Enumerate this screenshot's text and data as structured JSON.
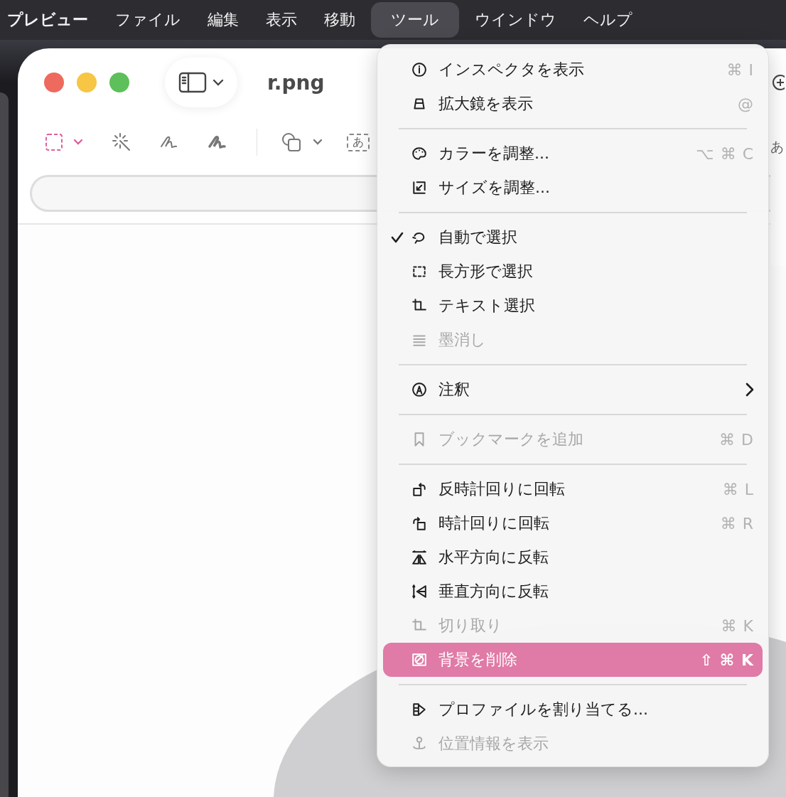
{
  "menu_bar": [
    {
      "label": "プレビュー",
      "selected": false,
      "app": true
    },
    {
      "label": "ファイル",
      "selected": false,
      "app": false
    },
    {
      "label": "編集",
      "selected": false,
      "app": false
    },
    {
      "label": "表示",
      "selected": false,
      "app": false
    },
    {
      "label": "移動",
      "selected": false,
      "app": false
    },
    {
      "label": "ツール",
      "selected": true,
      "app": false
    },
    {
      "label": "ウインドウ",
      "selected": false,
      "app": false
    },
    {
      "label": "ヘルプ",
      "selected": false,
      "app": false
    }
  ],
  "window": {
    "title": "r.png",
    "text_box_tool": "あ",
    "side_text": "あ"
  },
  "menu": {
    "sections": [
      {
        "items": [
          {
            "label": "インスペクタを表示",
            "shortcut": "⌘ I",
            "checked": false,
            "disabled": false,
            "selected": false,
            "submenu": false
          },
          {
            "label": "拡大鏡を表示",
            "shortcut": "@",
            "checked": false,
            "disabled": false,
            "selected": false,
            "submenu": false
          }
        ]
      },
      {
        "items": [
          {
            "label": "カラーを調整...",
            "shortcut": "⌥ ⌘ C",
            "checked": false,
            "disabled": false,
            "selected": false,
            "submenu": false
          },
          {
            "label": "サイズを調整...",
            "checked": false,
            "disabled": false,
            "selected": false,
            "submenu": false
          }
        ]
      },
      {
        "items": [
          {
            "label": "自動で選択",
            "checked": true,
            "disabled": false,
            "selected": false,
            "submenu": false
          },
          {
            "label": "長方形で選択",
            "checked": false,
            "disabled": false,
            "selected": false,
            "submenu": false
          },
          {
            "label": "テキスト選択",
            "checked": false,
            "disabled": false,
            "selected": false,
            "submenu": false
          },
          {
            "label": "墨消し",
            "checked": false,
            "disabled": true,
            "selected": false,
            "submenu": false
          }
        ]
      },
      {
        "items": [
          {
            "label": "注釈",
            "checked": false,
            "disabled": false,
            "selected": false,
            "submenu": true
          }
        ]
      },
      {
        "items": [
          {
            "label": "ブックマークを追加",
            "shortcut": "⌘ D",
            "checked": false,
            "disabled": true,
            "selected": false,
            "submenu": false
          }
        ]
      },
      {
        "items": [
          {
            "label": "反時計回りに回転",
            "shortcut": "⌘ L",
            "checked": false,
            "disabled": false,
            "selected": false,
            "submenu": false
          },
          {
            "label": "時計回りに回転",
            "shortcut": "⌘ R",
            "checked": false,
            "disabled": false,
            "selected": false,
            "submenu": false
          },
          {
            "label": "水平方向に反転",
            "checked": false,
            "disabled": false,
            "selected": false,
            "submenu": false
          },
          {
            "label": "垂直方向に反転",
            "checked": false,
            "disabled": false,
            "selected": false,
            "submenu": false
          },
          {
            "label": "切り取り",
            "shortcut": "⌘ K",
            "checked": false,
            "disabled": true,
            "selected": false,
            "submenu": false
          },
          {
            "label": "背景を削除",
            "shortcut": "⇧ ⌘ K",
            "checked": false,
            "disabled": false,
            "selected": true,
            "submenu": false
          }
        ]
      },
      {
        "items": [
          {
            "label": "プロファイルを割り当てる...",
            "checked": false,
            "disabled": false,
            "selected": false,
            "submenu": false
          },
          {
            "label": "位置情報を表示",
            "checked": false,
            "disabled": true,
            "selected": false,
            "submenu": false
          }
        ]
      }
    ]
  }
}
